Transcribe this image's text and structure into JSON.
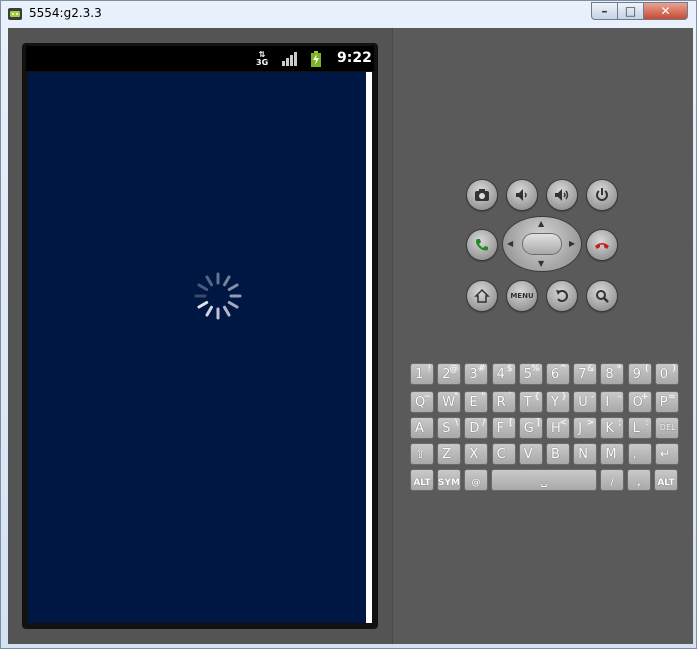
{
  "window": {
    "title": "5554:g2.3.3",
    "min_label": "–",
    "max_label": "□",
    "close_label": "✕"
  },
  "status_bar": {
    "network": "3G",
    "network_arrows": "⇅",
    "time": "9:22"
  },
  "screen": {
    "state": "loading"
  },
  "controls": {
    "row1": [
      {
        "icon": "camera-icon"
      },
      {
        "icon": "volume-down-icon"
      },
      {
        "icon": "volume-up-icon"
      },
      {
        "icon": "power-icon"
      }
    ],
    "row2": [
      {
        "icon": "call-icon"
      },
      {
        "icon": "end-call-icon"
      }
    ],
    "row3": [
      {
        "icon": "home-icon"
      },
      {
        "label": "MENU"
      },
      {
        "icon": "back-icon"
      },
      {
        "icon": "search-icon"
      }
    ]
  },
  "keyboard": {
    "row1": [
      {
        "main": "1",
        "sub": "!"
      },
      {
        "main": "2",
        "sub": "@"
      },
      {
        "main": "3",
        "sub": "#"
      },
      {
        "main": "4",
        "sub": "$"
      },
      {
        "main": "5",
        "sub": "%"
      },
      {
        "main": "6",
        "sub": "^"
      },
      {
        "main": "7",
        "sub": "&"
      },
      {
        "main": "8",
        "sub": "*"
      },
      {
        "main": "9",
        "sub": "("
      },
      {
        "main": "0",
        "sub": ")"
      }
    ],
    "row2": [
      {
        "main": "Q",
        "sub": "~"
      },
      {
        "main": "W",
        "sub": "\""
      },
      {
        "main": "E",
        "sub": "\""
      },
      {
        "main": "R",
        "sub": "`"
      },
      {
        "main": "T",
        "sub": "{"
      },
      {
        "main": "Y",
        "sub": "}"
      },
      {
        "main": "U",
        "sub": "-"
      },
      {
        "main": "I",
        "sub": "-"
      },
      {
        "main": "O",
        "sub": "+"
      },
      {
        "main": "P",
        "sub": "="
      }
    ],
    "row3": [
      {
        "main": "A",
        "sub": ""
      },
      {
        "main": "S",
        "sub": "\\"
      },
      {
        "main": "D",
        "sub": "/"
      },
      {
        "main": "F",
        "sub": "["
      },
      {
        "main": "G",
        "sub": "]"
      },
      {
        "main": "H",
        "sub": "<"
      },
      {
        "main": "J",
        "sub": ">"
      },
      {
        "main": "K",
        "sub": ";"
      },
      {
        "main": "L",
        "sub": ":"
      },
      {
        "main": "DEL",
        "sub": ""
      }
    ],
    "row4": [
      {
        "main": "⇧",
        "sub": ""
      },
      {
        "main": "Z",
        "sub": ""
      },
      {
        "main": "X",
        "sub": ""
      },
      {
        "main": "C",
        "sub": ""
      },
      {
        "main": "V",
        "sub": ""
      },
      {
        "main": "B",
        "sub": ""
      },
      {
        "main": "N",
        "sub": ""
      },
      {
        "main": "M",
        "sub": ""
      },
      {
        "main": ".",
        "sub": ""
      },
      {
        "main": "↵",
        "sub": ""
      }
    ],
    "row5": {
      "alt_left": "ALT",
      "sym": "SYM",
      "at": "@",
      "space": "␣",
      "slash": "/",
      "question": "?",
      "comma": ",",
      "alt_right": "ALT"
    }
  }
}
